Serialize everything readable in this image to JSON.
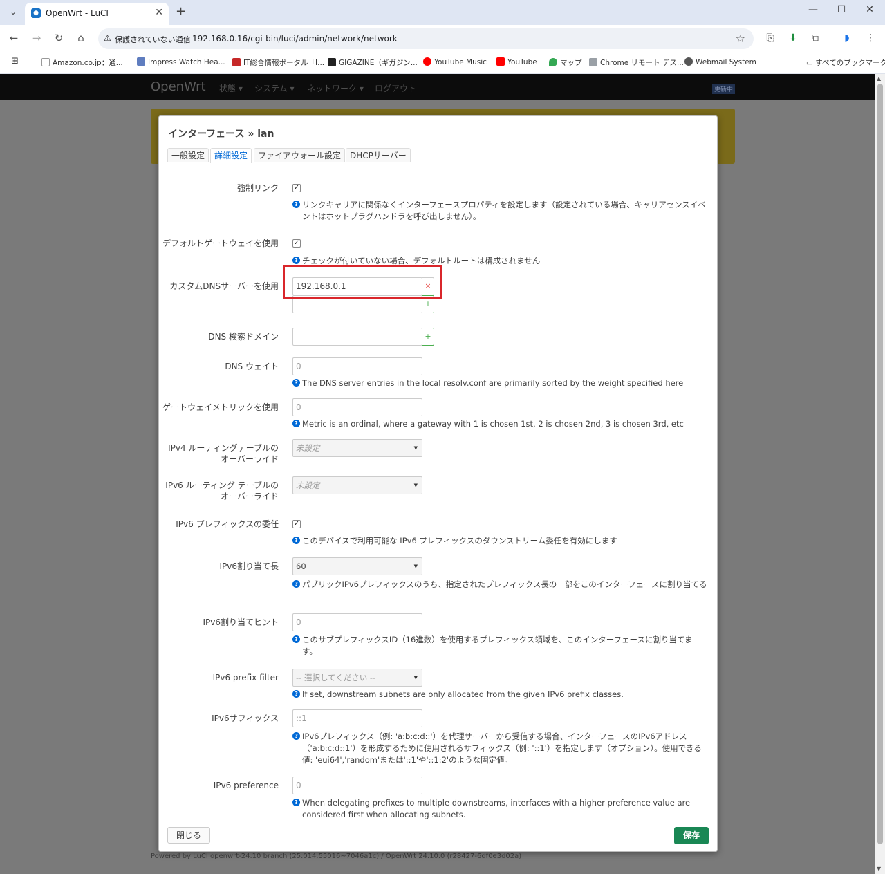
{
  "browser": {
    "tab_title": "OpenWrt - LuCI",
    "security_label": "保護されていない通信",
    "url": "192.168.0.16/cgi-bin/luci/admin/network/network",
    "bookmarks": [
      "Amazon.co.jp：通...",
      "Impress Watch Hea...",
      "IT総合情報ポータル「I...",
      "GIGAZINE（ギガジン...",
      "YouTube Music",
      "YouTube",
      "マップ",
      "Chrome リモート デス...",
      "Webmail System"
    ],
    "all_bookmarks": "すべてのブックマーク"
  },
  "luci": {
    "brand": "OpenWrt",
    "menu": [
      "状態 ▾",
      "システム ▾",
      "ネットワーク ▾",
      "ログアウト"
    ],
    "update_badge": "更新中",
    "footer": "Powered by LuCI openwrt-24.10 branch (25.014.55016~7046a1c) / OpenWrt 24.10.0 (r28427-6df0e3d02a)"
  },
  "modal": {
    "title": "インターフェース » lan",
    "tabs": [
      "一般設定",
      "詳細設定",
      "ファイアウォール設定",
      "DHCPサーバー"
    ],
    "fields": {
      "force_link": {
        "label": "強制リンク",
        "desc": "リンクキャリアに関係なくインターフェースプロパティを設定します（設定されている場合、キャリアセンスイベントはホットプラグハンドラを呼び出しません）。"
      },
      "default_gw": {
        "label": "デフォルトゲートウェイを使用",
        "desc": "チェックが付いていない場合、デフォルトルートは構成されません"
      },
      "custom_dns": {
        "label": "カスタムDNSサーバーを使用",
        "value": "192.168.0.1",
        "remove": "×",
        "add": "+"
      },
      "dns_search": {
        "label": "DNS 検索ドメイン",
        "add": "+"
      },
      "dns_weight": {
        "label": "DNS ウェイト",
        "value": "0",
        "desc": "The DNS server entries in the local resolv.conf are primarily sorted by the weight specified here"
      },
      "gw_metric": {
        "label": "ゲートウェイメトリックを使用",
        "value": "0",
        "desc": "Metric is an ordinal, where a gateway with 1 is chosen 1st, 2 is chosen 2nd, 3 is chosen 3rd, etc"
      },
      "ipv4_table": {
        "label": "IPv4 ルーティングテーブルのオーバーライド",
        "value": "未設定"
      },
      "ipv6_table": {
        "label": "IPv6 ルーティング テーブルのオーバーライド",
        "value": "未設定"
      },
      "ipv6_delegate": {
        "label": "IPv6 プレフィックスの委任",
        "desc": "このデバイスで利用可能な IPv6 プレフィックスのダウンストリーム委任を有効にします"
      },
      "ip6assign": {
        "label": "IPv6割り当て長",
        "value": "60",
        "desc": "パブリックIPv6プレフィックスのうち、指定されたプレフィックス長の一部をこのインターフェースに割り当てる"
      },
      "ip6hint": {
        "label": "IPv6割り当てヒント",
        "value": "0",
        "desc": "このサブプレフィックスID（16進数）を使用するプレフィックス領域を、このインターフェースに割り当てます。"
      },
      "ip6class": {
        "label": "IPv6 prefix filter",
        "value": "-- 選択してください --",
        "desc": "If set, downstream subnets are only allocated from the given IPv6 prefix classes."
      },
      "ip6ifaceid": {
        "label": "IPv6サフィックス",
        "value": "::1",
        "desc": "IPv6プレフィックス（例: 'a:b:c:d::'）を代理サーバーから受信する場合、インターフェースのIPv6アドレス（'a:b:c:d::1'）を形成するために使用されるサフィックス（例: '::1'）を指定します（オプション）。使用できる値: 'eui64','random'または'::1'や'::1:2'のような固定値。"
      },
      "ip6weight": {
        "label": "IPv6 preference",
        "value": "0",
        "desc": "When delegating prefixes to multiple downstreams, interfaces with a higher preference value are considered first when allocating subnets."
      }
    },
    "close_label": "閉じる",
    "save_label": "保存",
    "checked_mark": "✓",
    "help_mark": "?"
  }
}
